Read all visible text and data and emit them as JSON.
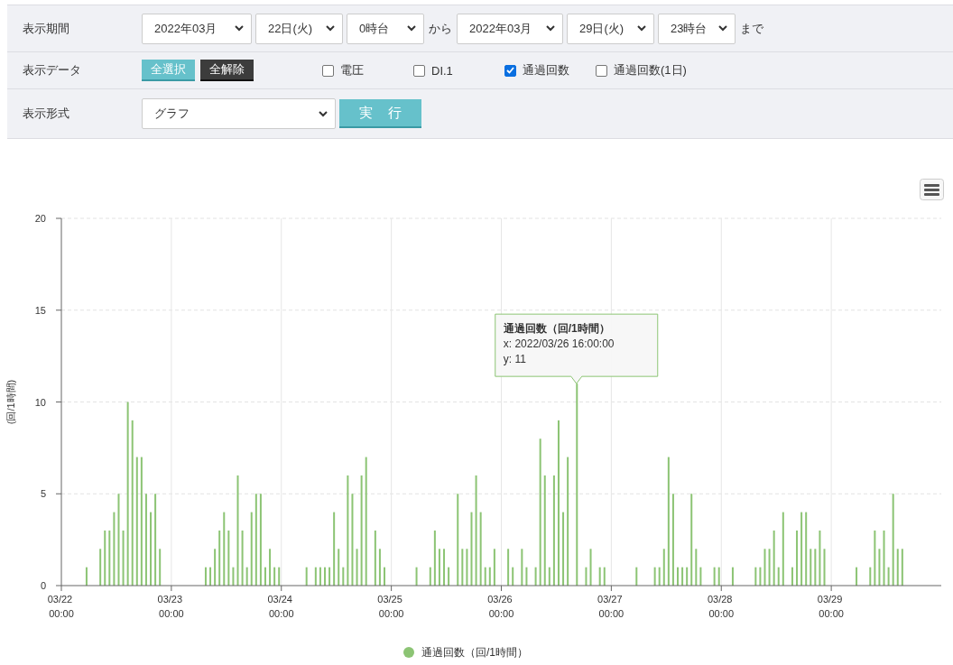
{
  "period": {
    "label": "表示期間",
    "start": [
      "2022年03月",
      "22日(火)",
      "0時台"
    ],
    "from_text": "から",
    "end": [
      "2022年03月",
      "29日(火)",
      "23時台"
    ],
    "until_text": "まで"
  },
  "data_select": {
    "label": "表示データ",
    "select_all": "全選択",
    "clear_all": "全解除",
    "options": [
      {
        "label": "電圧",
        "checked": false
      },
      {
        "label": "DI.1",
        "checked": false
      },
      {
        "label": "通過回数",
        "checked": true
      },
      {
        "label": "通過回数(1日)",
        "checked": false
      }
    ]
  },
  "format": {
    "label": "表示形式",
    "value": "グラフ",
    "run": "実　行"
  },
  "chart": {
    "chart_data": {
      "type": "bar",
      "ylabel": "(回/1時間)",
      "categories": [
        "03/22 00:00",
        null,
        null,
        null,
        null,
        null,
        null,
        null,
        null,
        null,
        null,
        null,
        null,
        null,
        null,
        null,
        null,
        null,
        null,
        null,
        null,
        null,
        null,
        null,
        "03/23 00:00",
        null,
        null,
        null,
        null,
        null,
        null,
        null,
        null,
        null,
        null,
        null,
        null,
        null,
        null,
        null,
        null,
        null,
        null,
        null,
        null,
        null,
        null,
        null,
        "03/24 00:00",
        null,
        null,
        null,
        null,
        null,
        null,
        null,
        null,
        null,
        null,
        null,
        null,
        null,
        null,
        null,
        null,
        null,
        null,
        null,
        null,
        null,
        null,
        null,
        "03/25 00:00",
        null,
        null,
        null,
        null,
        null,
        null,
        null,
        null,
        null,
        null,
        null,
        null,
        null,
        null,
        null,
        null,
        null,
        null,
        null,
        null,
        null,
        null,
        null,
        "03/26 00:00",
        null,
        null,
        null,
        null,
        null,
        null,
        null,
        null,
        null,
        null,
        null,
        null,
        null,
        null,
        null,
        null,
        null,
        null,
        null,
        null,
        null,
        null,
        null,
        "03/27 00:00",
        null,
        null,
        null,
        null,
        null,
        null,
        null,
        null,
        null,
        null,
        null,
        null,
        null,
        null,
        null,
        null,
        null,
        null,
        null,
        null,
        null,
        null,
        null,
        "03/28 00:00",
        null,
        null,
        null,
        null,
        null,
        null,
        null,
        null,
        null,
        null,
        null,
        null,
        null,
        null,
        null,
        null,
        null,
        null,
        null,
        null,
        null,
        null,
        null,
        "03/29 00:00",
        null,
        null,
        null,
        null,
        null,
        null,
        null,
        null,
        null,
        null,
        null,
        null,
        null,
        null,
        null,
        null,
        null,
        null,
        null,
        null,
        null,
        null,
        null
      ],
      "grid": true,
      "ylim": [
        0,
        20
      ],
      "yticks": [
        0,
        5,
        10,
        15,
        20
      ],
      "series": [
        {
          "name": "通過回数（回/1時間）",
          "color": "#8cc474",
          "values": [
            0,
            0,
            0,
            0,
            0,
            1,
            0,
            0,
            2,
            3,
            3,
            4,
            5,
            3,
            10,
            9,
            7,
            7,
            5,
            4,
            5,
            2,
            0,
            0,
            0,
            0,
            0,
            0,
            0,
            0,
            0,
            1,
            1,
            2,
            3,
            4,
            3,
            1,
            6,
            3,
            1,
            4,
            5,
            5,
            1,
            2,
            1,
            1,
            0,
            0,
            0,
            0,
            0,
            1,
            0,
            1,
            1,
            1,
            1,
            4,
            2,
            1,
            6,
            5,
            2,
            6,
            7,
            0,
            3,
            2,
            1,
            0,
            0,
            0,
            0,
            0,
            0,
            1,
            0,
            0,
            1,
            3,
            2,
            2,
            1,
            0,
            5,
            2,
            2,
            4,
            6,
            4,
            1,
            1,
            2,
            0,
            0,
            2,
            1,
            0,
            2,
            1,
            0,
            1,
            8,
            6,
            1,
            6,
            9,
            4,
            7,
            0,
            11,
            0,
            1,
            2,
            0,
            1,
            1,
            0,
            0,
            0,
            0,
            0,
            0,
            1,
            0,
            0,
            0,
            1,
            1,
            2,
            7,
            5,
            1,
            1,
            1,
            5,
            2,
            1,
            0,
            0,
            1,
            1,
            0,
            0,
            1,
            0,
            0,
            0,
            0,
            1,
            1,
            2,
            2,
            3,
            1,
            4,
            0,
            1,
            3,
            4,
            4,
            2,
            2,
            3,
            2,
            0,
            0,
            0,
            0,
            0,
            0,
            1,
            0,
            0,
            1,
            3,
            2,
            3,
            1,
            5,
            2,
            2,
            0,
            0,
            0,
            0,
            0,
            0,
            0,
            0
          ]
        }
      ]
    },
    "tooltip": {
      "title": "通過回数（回/1時間）",
      "x": "x: 2022/03/26 16:00:00",
      "y": "y: 11"
    }
  }
}
